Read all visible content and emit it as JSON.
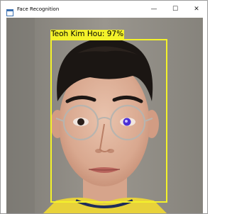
{
  "window": {
    "title": "Face Recognition",
    "controls": {
      "minimize": "—",
      "maximize": "☐",
      "close": "✕"
    }
  },
  "detection": {
    "label": "Teoh Kim Hou: 97%",
    "box_color": "#f4f22a"
  },
  "icons": {
    "app": "app-window-icon",
    "minimize": "minimize-icon",
    "maximize": "maximize-icon",
    "close": "close-icon"
  }
}
